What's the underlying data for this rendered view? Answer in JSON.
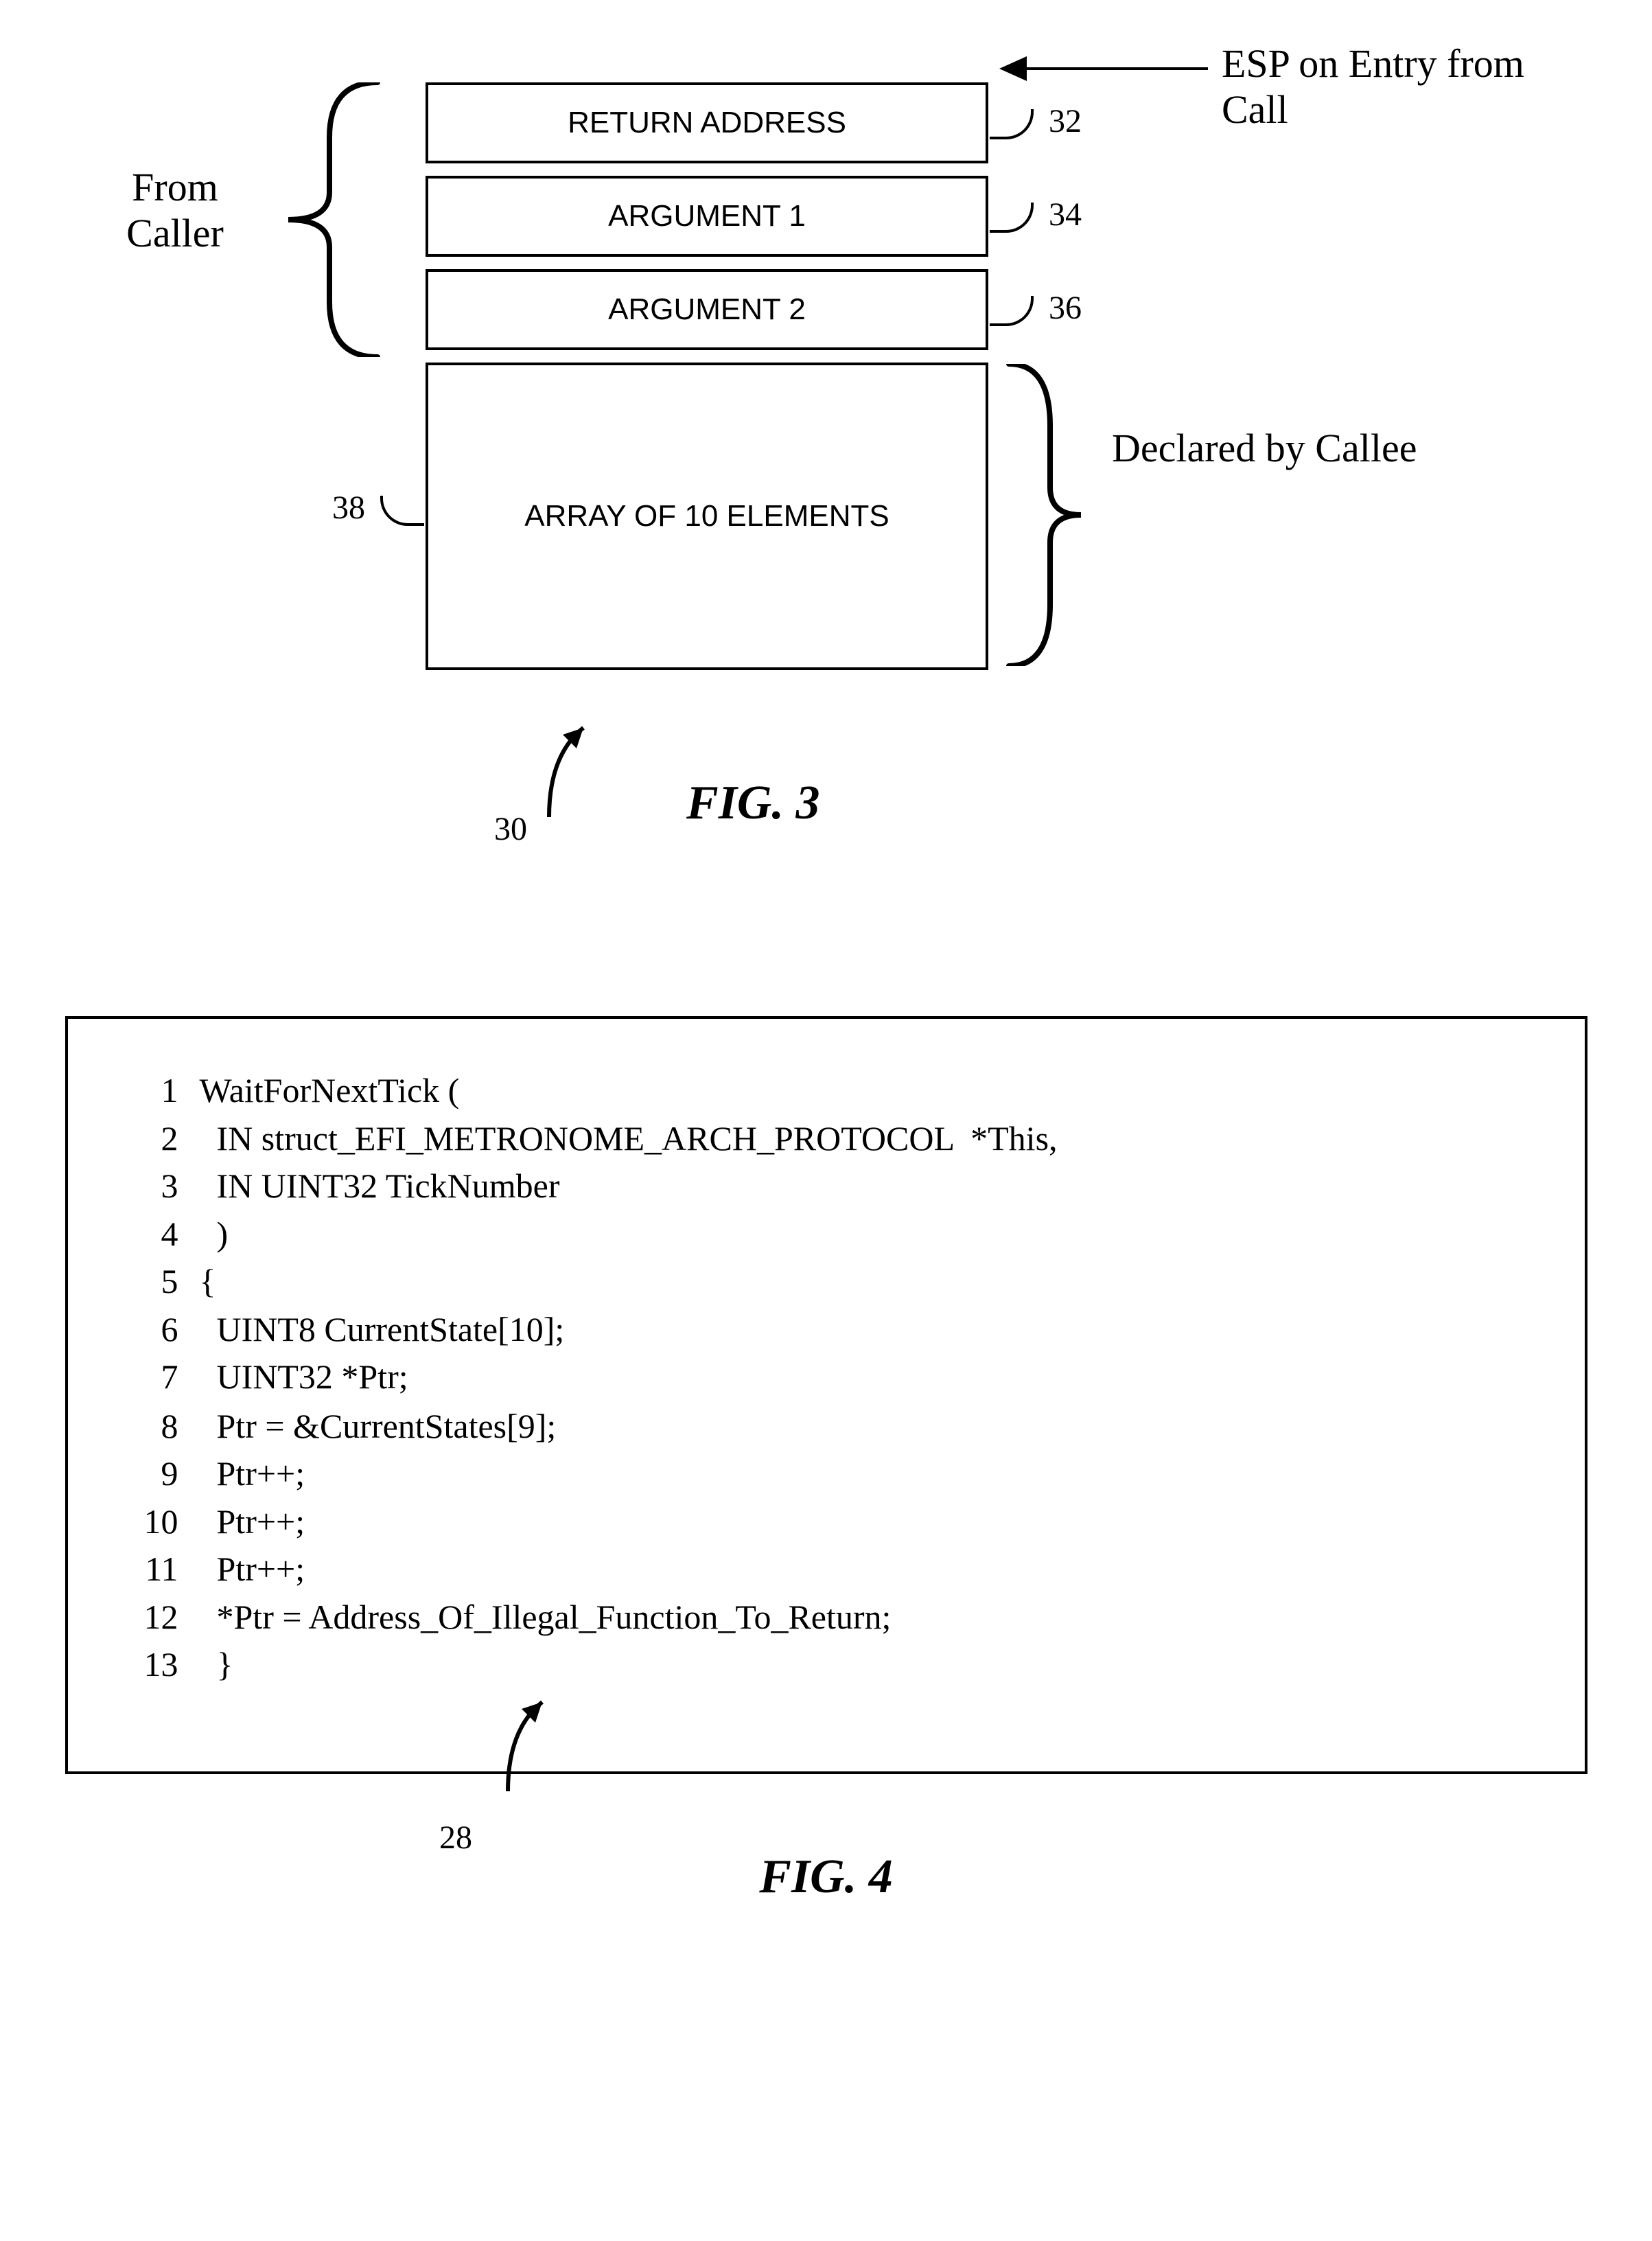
{
  "fig3": {
    "caption": "FIG. 3",
    "esp_label": "ESP on Entry from Call",
    "caller_label": "From Caller",
    "callee_label": "Declared by Callee",
    "ref30": "30",
    "boxes": {
      "b32": {
        "text": "RETURN ADDRESS",
        "ref": "32"
      },
      "b34": {
        "text": "ARGUMENT 1",
        "ref": "34"
      },
      "b36": {
        "text": "ARGUMENT 2",
        "ref": "36"
      },
      "b38": {
        "text": "ARRAY OF 10 ELEMENTS",
        "ref": "38"
      }
    }
  },
  "fig4": {
    "caption": "FIG. 4",
    "ref28": "28",
    "code": [
      {
        "n": "1",
        "t": "WaitForNextTick ("
      },
      {
        "n": "2",
        "t": "  IN struct_EFI_METRONOME_ARCH_PROTOCOL  *This,"
      },
      {
        "n": "3",
        "t": "  IN UINT32 TickNumber"
      },
      {
        "n": "4",
        "t": "  )"
      },
      {
        "n": "5",
        "t": "{"
      },
      {
        "n": "6",
        "t": "  UINT8 CurrentState[10];"
      },
      {
        "n": "7",
        "t": "  UINT32 *Ptr;"
      },
      {
        "n": "",
        "t": ""
      },
      {
        "n": "8",
        "t": "  Ptr = &CurrentStates[9];"
      },
      {
        "n": "9",
        "t": "  Ptr++;"
      },
      {
        "n": "10",
        "t": "  Ptr++;"
      },
      {
        "n": "11",
        "t": "  Ptr++;"
      },
      {
        "n": "12",
        "t": "  *Ptr = Address_Of_Illegal_Function_To_Return;"
      },
      {
        "n": "13",
        "t": "  }"
      }
    ]
  }
}
